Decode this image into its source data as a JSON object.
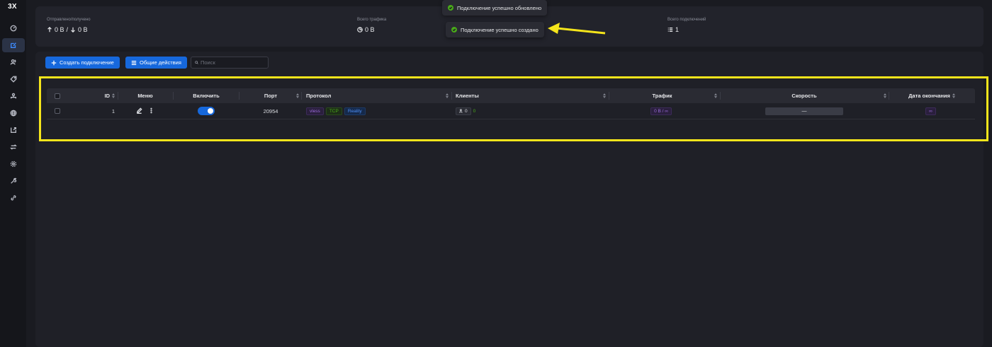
{
  "app": {
    "logo": "3X"
  },
  "sidebar": {
    "items": [
      {
        "name": "dashboard-icon",
        "active": false
      },
      {
        "name": "inbounds-icon",
        "active": true
      },
      {
        "name": "users-icon",
        "active": false
      },
      {
        "name": "tag-icon",
        "active": false
      },
      {
        "name": "team-icon",
        "active": false
      },
      {
        "name": "globe-icon",
        "active": false
      },
      {
        "name": "export-icon",
        "active": false
      },
      {
        "name": "swap-icon",
        "active": false
      },
      {
        "name": "gear-icon",
        "active": false
      },
      {
        "name": "tool-icon",
        "active": false
      },
      {
        "name": "link-icon",
        "active": false
      }
    ]
  },
  "stats": {
    "sent_received_label": "Отправлено/получено",
    "sent_value": "0 B",
    "separator": "/",
    "received_value": "0 B",
    "total_traffic_label": "Всего трафика",
    "total_traffic_value": "0 B",
    "total_connections_label": "Всего подключений",
    "total_connections_value": "1"
  },
  "toasts": [
    {
      "text": "Подключение успешно обновлено"
    },
    {
      "text": "Подключение успешно создано"
    }
  ],
  "toolbar": {
    "create_label": "Создать подключение",
    "general_actions_label": "Общие действия",
    "search_placeholder": "Поиск"
  },
  "table": {
    "headers": {
      "id": "ID",
      "menu": "Меню",
      "enable": "Включить",
      "port": "Порт",
      "protocol": "Протокол",
      "clients": "Клиенты",
      "traffic": "Трафик",
      "speed": "Скорость",
      "expiry": "Дата окончания"
    },
    "rows": [
      {
        "id": "1",
        "enabled": true,
        "port": "20954",
        "protocol_tags": [
          "vless",
          "TCP",
          "Reality"
        ],
        "clients_total": "0",
        "clients_online": "0",
        "traffic": "0 B / ∞",
        "speed": "—",
        "expiry": "∞"
      }
    ]
  },
  "colors": {
    "accent": "#1668dc",
    "success": "#49aa19",
    "highlight": "#f5e51b",
    "background": "#1a1b21"
  }
}
